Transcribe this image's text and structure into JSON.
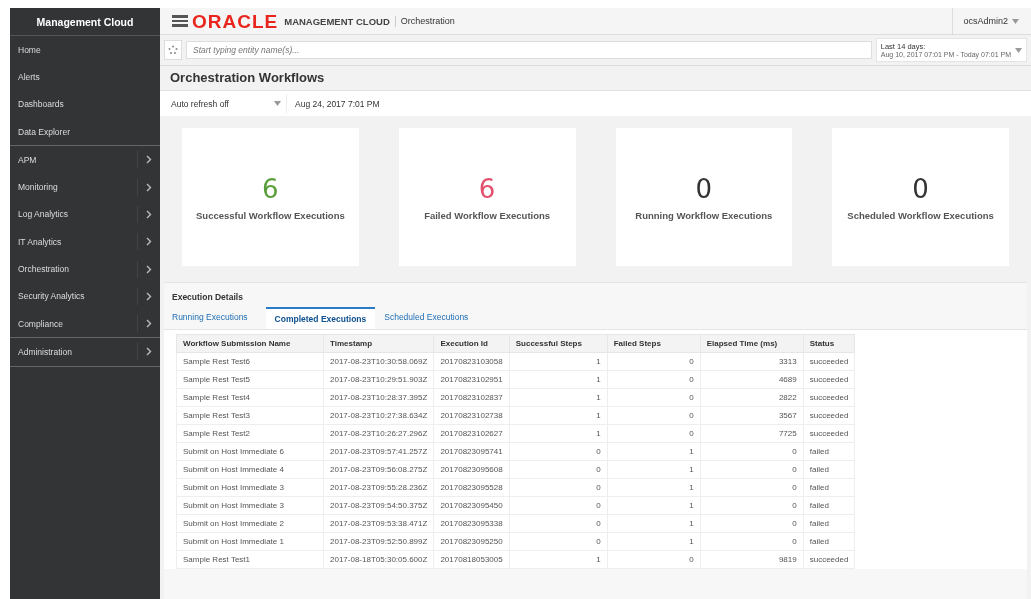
{
  "sidebar": {
    "title": "Management Cloud",
    "groups": [
      {
        "items": [
          {
            "label": "Home",
            "has_submenu": false
          },
          {
            "label": "Alerts",
            "has_submenu": false
          },
          {
            "label": "Dashboards",
            "has_submenu": false
          },
          {
            "label": "Data Explorer",
            "has_submenu": false
          }
        ]
      },
      {
        "items": [
          {
            "label": "APM",
            "has_submenu": true
          },
          {
            "label": "Monitoring",
            "has_submenu": true
          },
          {
            "label": "Log Analytics",
            "has_submenu": true
          },
          {
            "label": "IT Analytics",
            "has_submenu": true
          },
          {
            "label": "Orchestration",
            "has_submenu": true
          },
          {
            "label": "Security Analytics",
            "has_submenu": true
          },
          {
            "label": "Compliance",
            "has_submenu": true
          }
        ]
      },
      {
        "items": [
          {
            "label": "Administration",
            "has_submenu": true
          }
        ]
      }
    ]
  },
  "header": {
    "logo": "ORACLE",
    "product": "MANAGEMENT CLOUD",
    "section": "Orchestration",
    "user": "ocsAdmin2"
  },
  "search": {
    "placeholder": "Start typing entity name(s)...",
    "time_range": {
      "label": "Last 14 days:",
      "range": "Aug 10, 2017 07:01 PM - Today 07:01 PM"
    }
  },
  "page_title": "Orchestration Workflows",
  "toolbar": {
    "refresh": "Auto refresh off",
    "timestamp": "Aug 24, 2017 7:01 PM"
  },
  "cards": [
    {
      "value": "6",
      "label": "Successful Workflow Executions",
      "color": "#5a9e3a"
    },
    {
      "value": "6",
      "label": "Failed Workflow Executions",
      "color": "#e2506e"
    },
    {
      "value": "0",
      "label": "Running Workflow Executions",
      "color": "#333333"
    },
    {
      "value": "0",
      "label": "Scheduled Workflow Executions",
      "color": "#333333"
    }
  ],
  "details": {
    "title": "Execution Details",
    "tabs": [
      {
        "label": "Running Executions",
        "selected": false
      },
      {
        "label": "Completed Executions",
        "selected": true
      },
      {
        "label": "Scheduled Executions",
        "selected": false
      }
    ],
    "table": {
      "columns": [
        "Workflow Submission Name",
        "Timestamp",
        "Execution Id",
        "Successful Steps",
        "Failed Steps",
        "Elapsed Time (ms)",
        "Status"
      ],
      "rows": [
        [
          "Sample Rest Test6",
          "2017-08-23T10:30:58.069Z",
          "20170823103058",
          "1",
          "0",
          "3313",
          "succeeded"
        ],
        [
          "Sample Rest Test5",
          "2017-08-23T10:29:51.903Z",
          "20170823102951",
          "1",
          "0",
          "4689",
          "succeeded"
        ],
        [
          "Sample Rest Test4",
          "2017-08-23T10:28:37.395Z",
          "20170823102837",
          "1",
          "0",
          "2822",
          "succeeded"
        ],
        [
          "Sample Rest Test3",
          "2017-08-23T10:27:38.634Z",
          "20170823102738",
          "1",
          "0",
          "3567",
          "succeeded"
        ],
        [
          "Sample Rest Test2",
          "2017-08-23T10:26:27.296Z",
          "20170823102627",
          "1",
          "0",
          "7725",
          "succeeded"
        ],
        [
          "Submit on Host Immediate 6",
          "2017-08-23T09:57:41.257Z",
          "20170823095741",
          "0",
          "1",
          "0",
          "failed"
        ],
        [
          "Submit on Host Immediate 4",
          "2017-08-23T09:56:08.275Z",
          "20170823095608",
          "0",
          "1",
          "0",
          "failed"
        ],
        [
          "Submit on Host Immediate 3",
          "2017-08-23T09:55:28.236Z",
          "20170823095528",
          "0",
          "1",
          "0",
          "failed"
        ],
        [
          "Submit on Host Immediate 3",
          "2017-08-23T09:54:50.375Z",
          "20170823095450",
          "0",
          "1",
          "0",
          "failed"
        ],
        [
          "Submit on Host Immediate 2",
          "2017-08-23T09:53:38.471Z",
          "20170823095338",
          "0",
          "1",
          "0",
          "failed"
        ],
        [
          "Submit on Host Immediate 1",
          "2017-08-23T09:52:50.899Z",
          "20170823095250",
          "0",
          "1",
          "0",
          "failed"
        ],
        [
          "Sample Rest Test1",
          "2017-08-18T05:30:05.600Z",
          "20170818053005",
          "1",
          "0",
          "9819",
          "succeeded"
        ]
      ]
    }
  }
}
